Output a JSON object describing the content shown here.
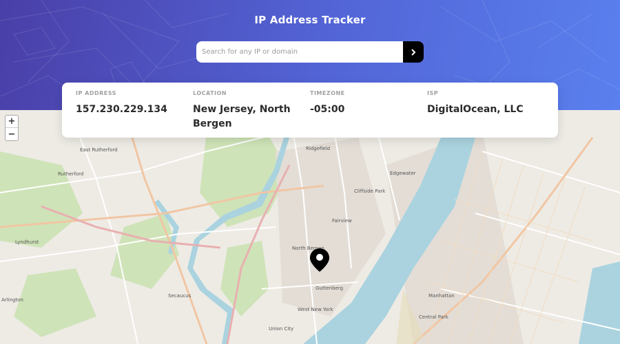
{
  "header": {
    "title": "IP Address Tracker",
    "search_placeholder": "Search for any IP or domain",
    "submit_icon": "chevron-right-icon"
  },
  "info": {
    "ip_label": "IP ADDRESS",
    "ip_value": "157.230.229.134",
    "location_label": "LOCATION",
    "location_value": "New Jersey, North Bergen",
    "timezone_label": "TIMEZONE",
    "timezone_value": "-05:00",
    "isp_label": "ISP",
    "isp_value": "DigitalOcean, LLC"
  },
  "map": {
    "zoom_in": "+",
    "zoom_out": "−",
    "marker_icon": "location-pin-icon",
    "labels": {
      "ridgefield": "Ridgefield",
      "east_rutherford": "East Rutherford",
      "rutherford": "Rutherford",
      "cliffside_park": "Cliffside Park",
      "edgewater": "Edgewater",
      "fairview": "Fairview",
      "lyndhurst": "Lyndhurst",
      "north_bergen": "North Bergen",
      "guttenberg": "Guttenberg",
      "west_new_york": "West New York",
      "secaucus": "Secaucus",
      "union_city": "Union City",
      "manhattan": "Manhattan",
      "arlington": "Arlington",
      "central_park": "Central Park"
    }
  },
  "colors": {
    "header_start": "#4a3fa8",
    "header_end": "#5a80ee",
    "water": "#aad3df",
    "park": "#c9dfb0"
  }
}
